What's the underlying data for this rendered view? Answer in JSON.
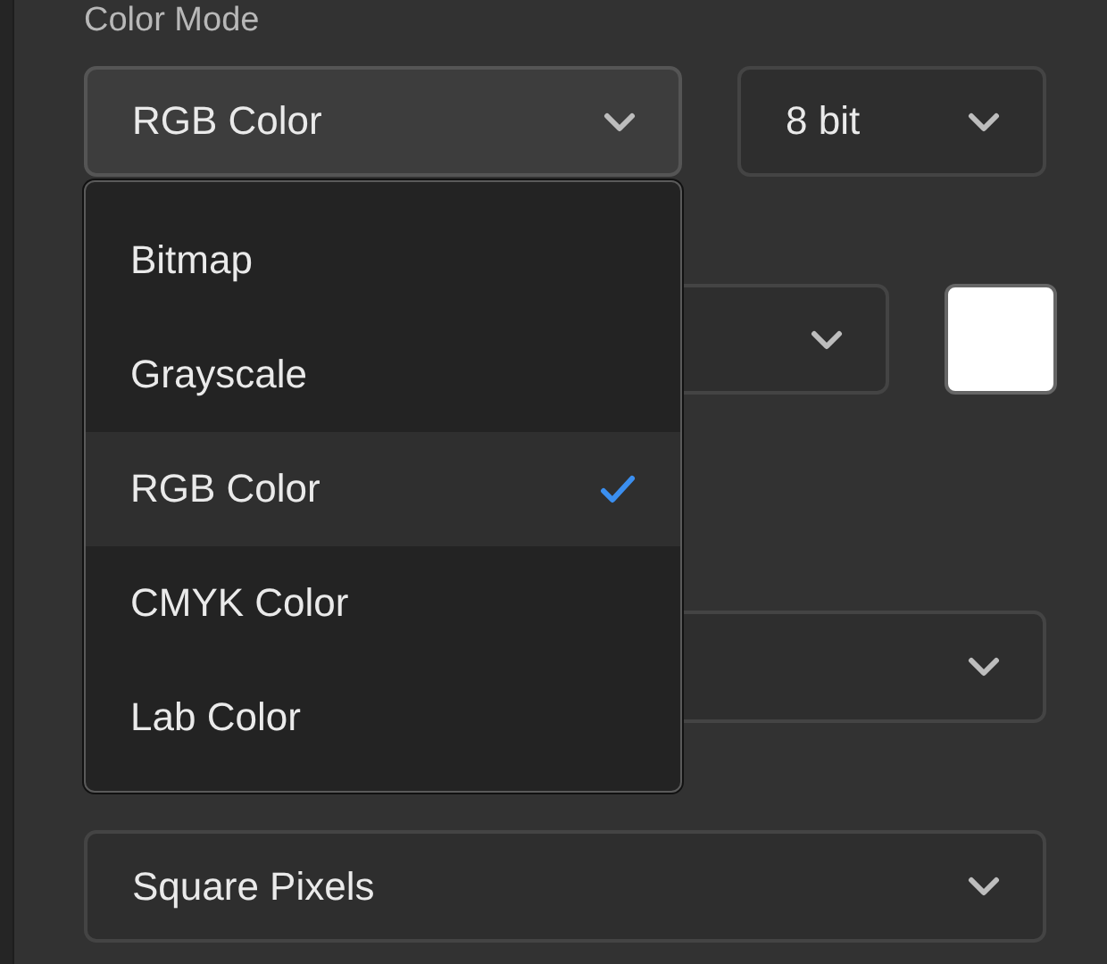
{
  "color_mode": {
    "label": "Color Mode",
    "mode_select": {
      "value": "RGB Color"
    },
    "depth_select": {
      "value": "8 bit"
    }
  },
  "background_fields": [
    {
      "kind": "select_with_swatch"
    },
    {
      "kind": "select"
    }
  ],
  "pixel_aspect_ratio": {
    "value": "Square Pixels"
  },
  "mode_menu": {
    "items": [
      {
        "label": "Bitmap",
        "selected": false
      },
      {
        "label": "Grayscale",
        "selected": false
      },
      {
        "label": "RGB Color",
        "selected": true
      },
      {
        "label": "CMYK Color",
        "selected": false
      },
      {
        "label": "Lab Color",
        "selected": false
      }
    ]
  }
}
